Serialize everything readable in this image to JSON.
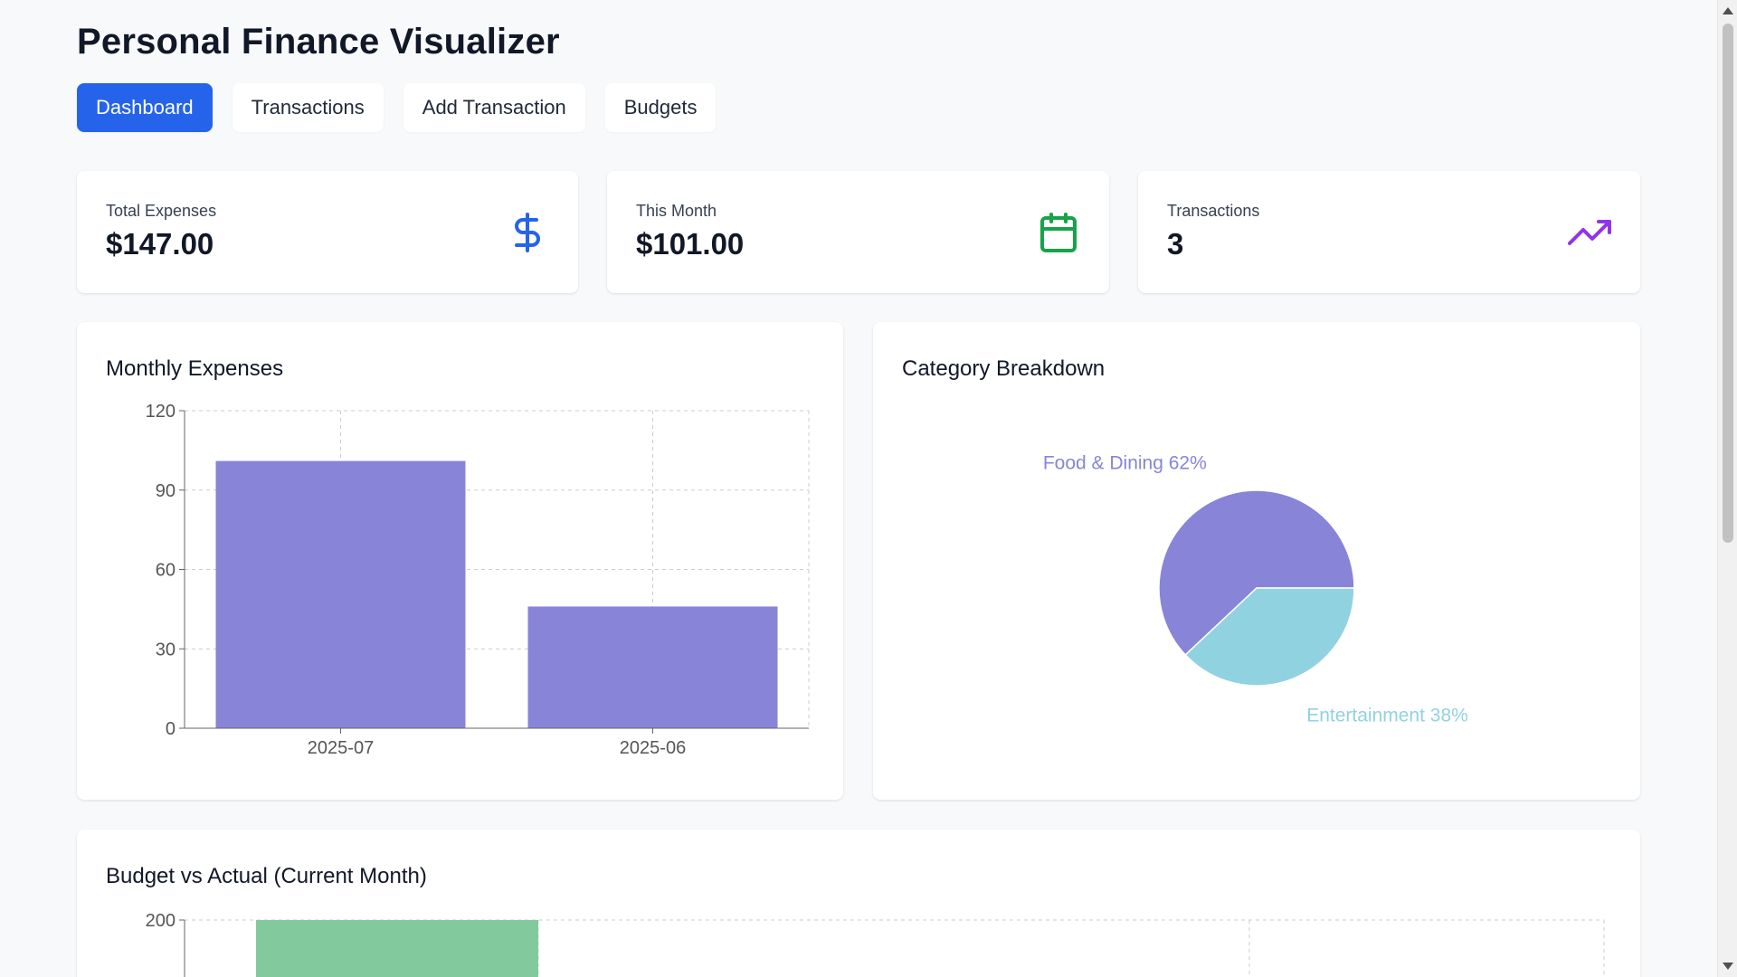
{
  "app": {
    "title": "Personal Finance Visualizer"
  },
  "nav": {
    "items": [
      {
        "label": "Dashboard",
        "active": true
      },
      {
        "label": "Transactions",
        "active": false
      },
      {
        "label": "Add Transaction",
        "active": false
      },
      {
        "label": "Budgets",
        "active": false
      }
    ]
  },
  "stats": [
    {
      "label": "Total Expenses",
      "value": "$147.00",
      "icon": "dollar-icon",
      "color": "#2563eb"
    },
    {
      "label": "This Month",
      "value": "$101.00",
      "icon": "calendar-icon",
      "color": "#16a34a"
    },
    {
      "label": "Transactions",
      "value": "3",
      "icon": "trending-up-icon",
      "color": "#9333ea"
    }
  ],
  "panels": {
    "monthly_title": "Monthly Expenses",
    "category_title": "Category Breakdown",
    "budget_title": "Budget vs Actual (Current Month)"
  },
  "colors": {
    "primary": "#2563eb",
    "bar": "#8884d8",
    "pie_secondary": "#91d2e1",
    "budget_bar": "#82ca9d"
  },
  "chart_data": [
    {
      "type": "bar",
      "title": "Monthly Expenses",
      "categories": [
        "2025-07",
        "2025-06"
      ],
      "values": [
        101,
        46
      ],
      "ylim": [
        0,
        120
      ],
      "yticks": [
        0,
        30,
        60,
        90,
        120
      ],
      "grid": true
    },
    {
      "type": "pie",
      "title": "Category Breakdown",
      "labels": [
        "Food & Dining",
        "Entertainment"
      ],
      "values": [
        62,
        38
      ],
      "slice_labels": [
        "Food & Dining 62%",
        "Entertainment 38%"
      ],
      "colors": [
        "#8884d8",
        "#91d2e1"
      ]
    },
    {
      "type": "bar",
      "title": "Budget vs Actual (Current Month)",
      "yticks": [
        200
      ],
      "values": [
        200
      ],
      "grid": true,
      "partially_visible": true
    }
  ]
}
